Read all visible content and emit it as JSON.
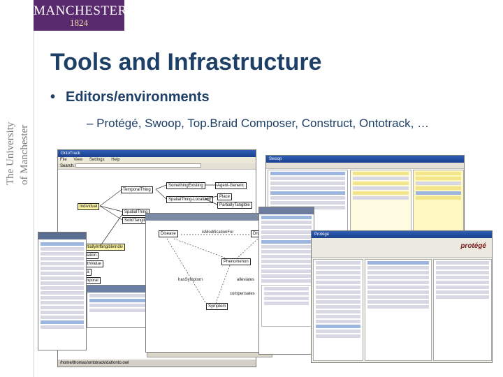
{
  "branding": {
    "logo_name": "MANCHESTER",
    "logo_year": "1824",
    "vertical_line1": "The University",
    "vertical_line2": "of Manchester"
  },
  "slide": {
    "title": "Tools and Infrastructure",
    "bullet1_marker": "•",
    "bullet1": "Editors/environments",
    "bullet2": "– Protégé, Swoop, Top.Braid Composer, Construct, Ontotrack, …"
  },
  "screenshots": {
    "left_window": {
      "menu": [
        "File",
        "View",
        "Settings",
        "Help"
      ],
      "search_label": "Search:",
      "nodes": [
        "TemporalThing",
        "SomethingExisting",
        "Agent-Generic",
        "Individual",
        "SpatialThing-Localized",
        "Place",
        "PartiallyTangible",
        "SpatialThing",
        "SolidTangibleThing",
        "PartiallyIntangibleIndiv",
        "Relation",
        "TruthValue",
        "Idea",
        "Temporal"
      ],
      "status": "/home/thomas/ontotrack/dat/onto.owl"
    },
    "middle_window": {
      "nodes": [
        "Disease",
        "isModificationFor",
        "Drug",
        "Phenomenon",
        "Symptom",
        "hasSymptom",
        "alleviates",
        "compensates"
      ]
    },
    "protege_window": {
      "logo": "protégé"
    }
  },
  "colors": {
    "title_blue": "#1e3f66",
    "logo_purple": "#5a2a6e",
    "logo_gold": "#e9d8a6",
    "titlebar_blue": "#2c5fb5"
  }
}
